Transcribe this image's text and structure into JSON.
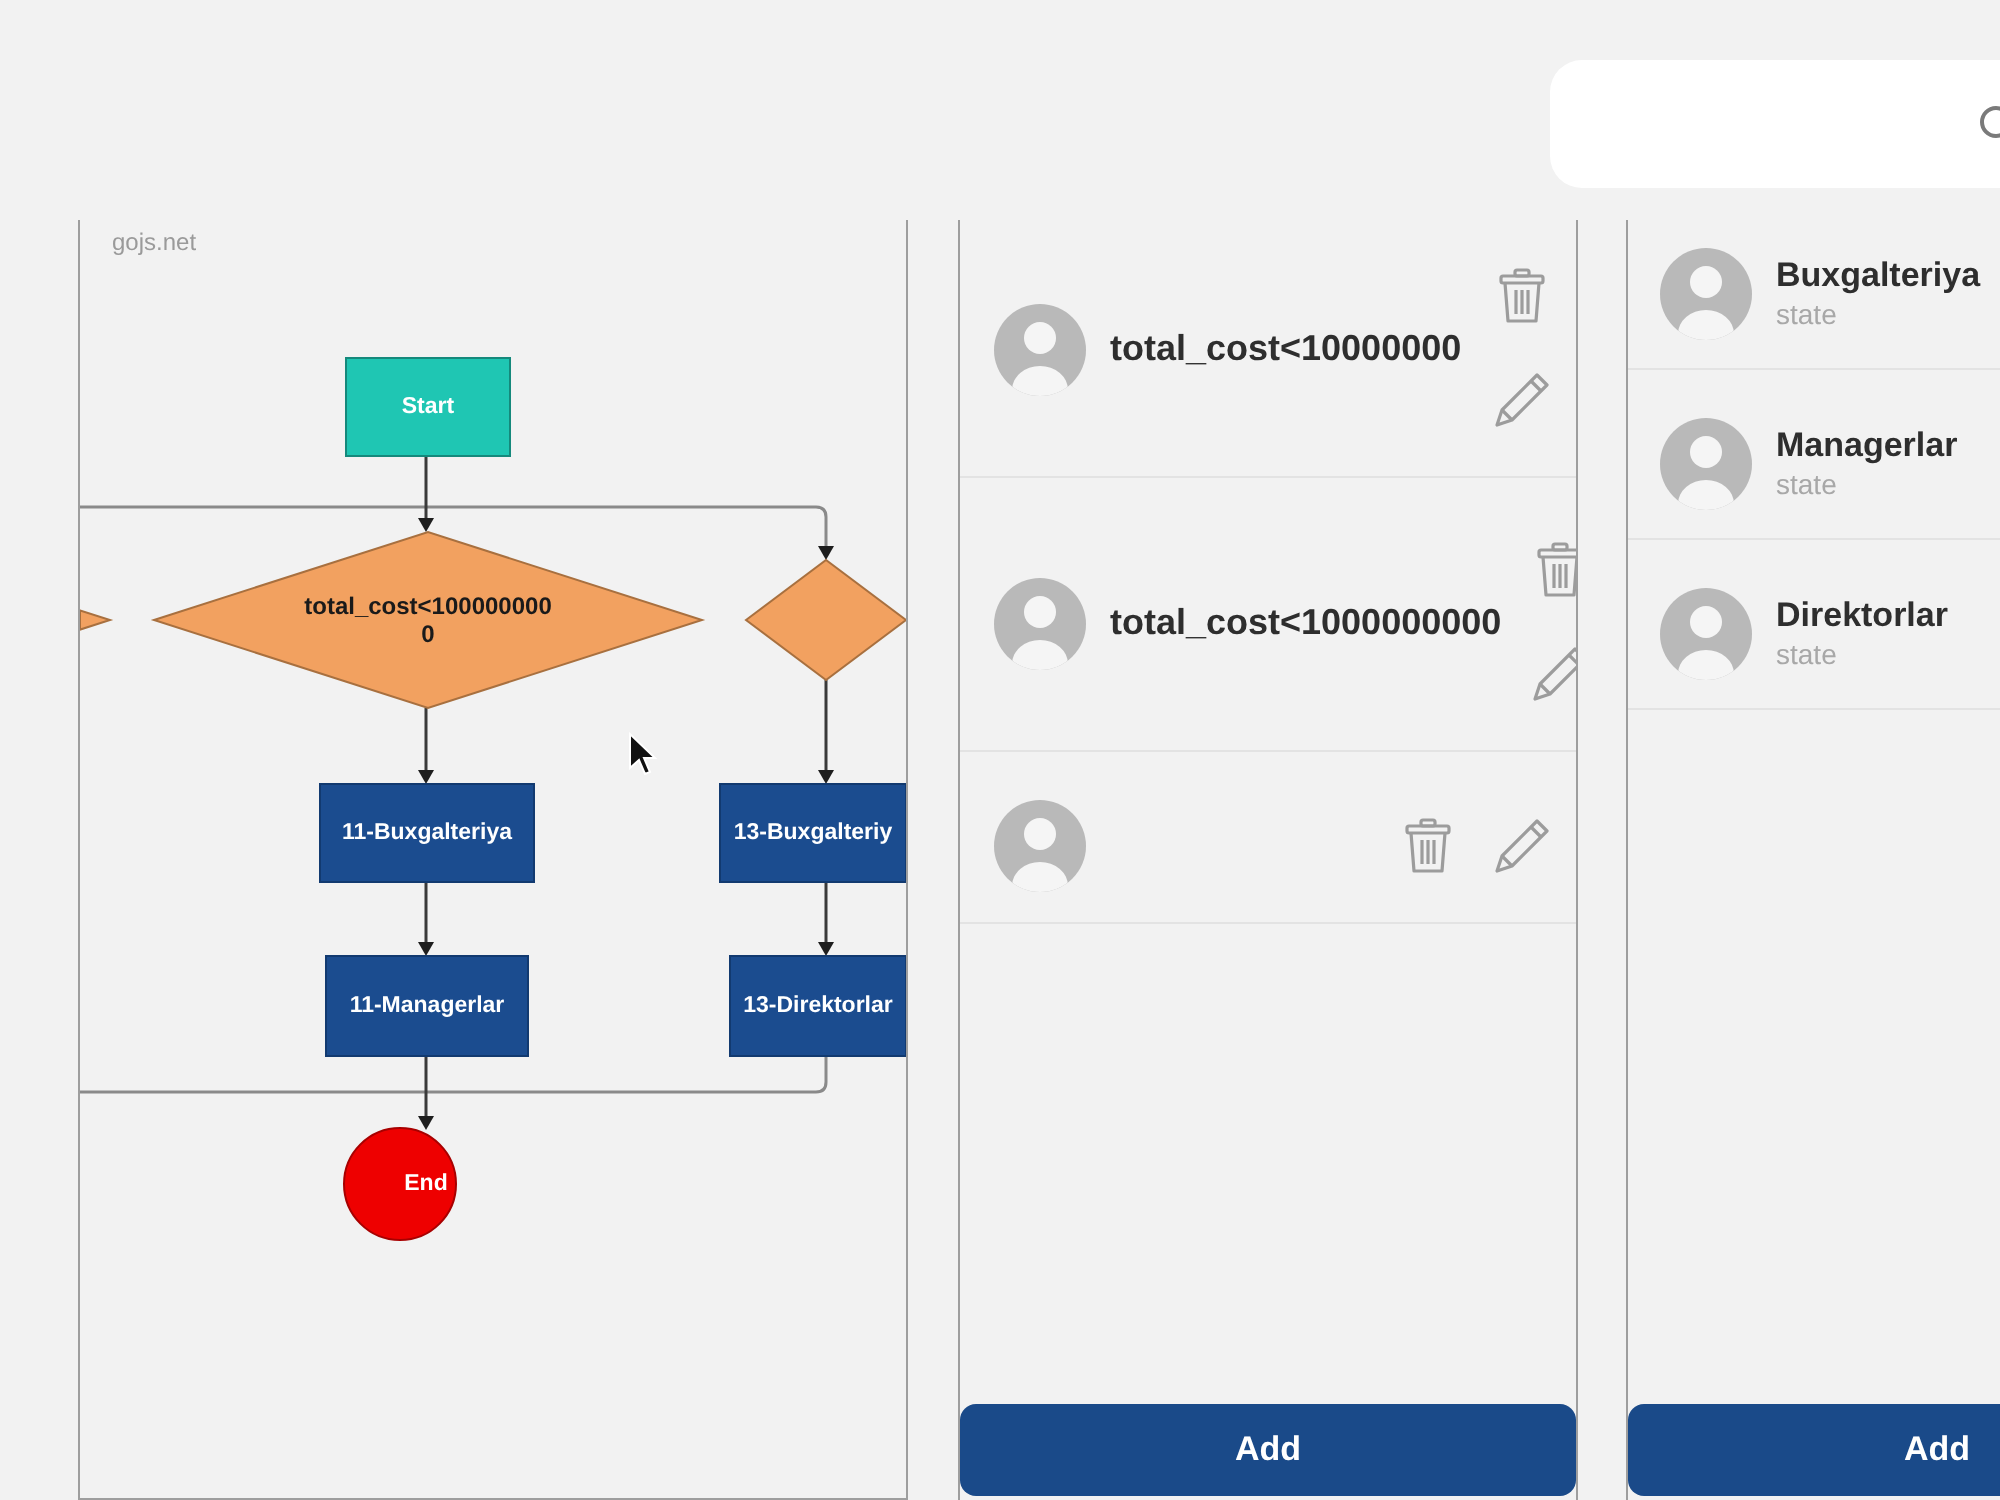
{
  "flowchart": {
    "site_credit": "gojs.net",
    "nodes": [
      {
        "kind": "start",
        "label": "Start"
      },
      {
        "kind": "decision"
      },
      {
        "kind": "decision",
        "label": "total_cost<1000000000"
      },
      {
        "kind": "decision"
      },
      {
        "kind": "process",
        "label": "11-Buxgalteriya"
      },
      {
        "kind": "process",
        "label": "13-Buxgalteriy"
      },
      {
        "kind": "process",
        "label": "11-Managerlar"
      },
      {
        "kind": "process",
        "label": "13-Direktorlar"
      },
      {
        "kind": "end",
        "label": "End"
      }
    ]
  },
  "condition_panel": {
    "items": [
      {
        "kind": "named",
        "title": "total_cost<10000000"
      },
      {
        "kind": "named",
        "title": "total_cost<1000000000"
      },
      {
        "kind": "blank"
      }
    ],
    "add_button": "Add"
  },
  "state_panel": {
    "items": [
      {
        "name": "Buxgalteriya",
        "subtitle": "state"
      },
      {
        "name": "Managerlar",
        "subtitle": "state"
      },
      {
        "name": "Direktorlar",
        "subtitle": "state"
      }
    ],
    "add_button": "Add"
  }
}
